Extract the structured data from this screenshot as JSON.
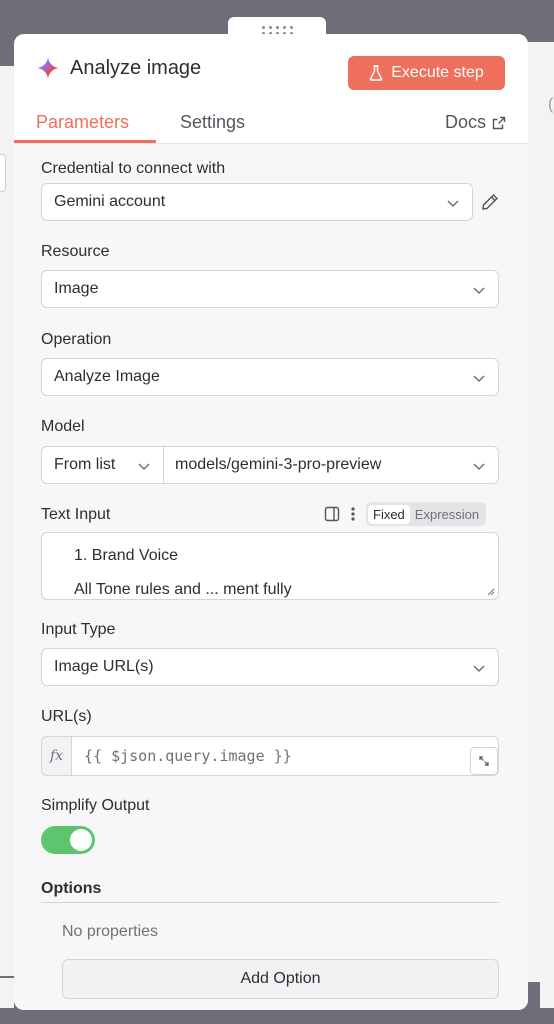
{
  "node": {
    "title": "Analyze image",
    "execute_label": "Execute step",
    "icon": "gemini-sparkle-icon"
  },
  "tabs": [
    {
      "label": "Parameters",
      "active": true
    },
    {
      "label": "Settings",
      "active": false
    }
  ],
  "docs_label": "Docs",
  "fields": {
    "credential": {
      "label": "Credential to connect with",
      "value": "Gemini account"
    },
    "resource": {
      "label": "Resource",
      "value": "Image"
    },
    "operation": {
      "label": "Operation",
      "value": "Analyze Image"
    },
    "model": {
      "label": "Model",
      "mode": "From list",
      "value": "models/gemini-3-pro-preview"
    },
    "text_input": {
      "label": "Text Input",
      "mode_fixed": "Fixed",
      "mode_expression": "Expression",
      "active_mode": "Fixed",
      "line1": "1. Brand Voice",
      "line2": "All Tone rules and ... ment fully"
    },
    "input_type": {
      "label": "Input Type",
      "value": "Image URL(s)"
    },
    "urls": {
      "label": "URL(s)",
      "fx": "fx",
      "value": "{{ $json.query.image }}"
    },
    "simplify": {
      "label": "Simplify Output",
      "enabled": true
    }
  },
  "options": {
    "label": "Options",
    "empty_text": "No properties",
    "add_label": "Add Option"
  },
  "colors": {
    "accent": "#ee6f5c",
    "toggle_on": "#5ec46e"
  }
}
